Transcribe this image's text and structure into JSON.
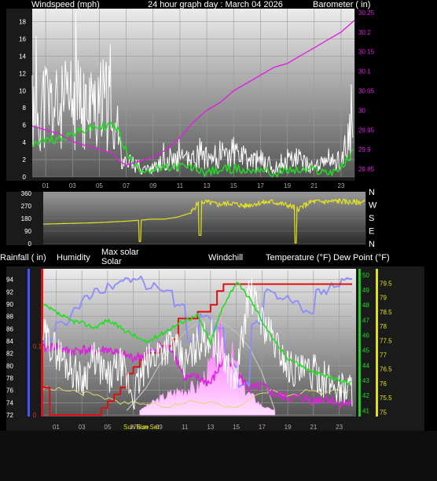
{
  "header": {
    "wind_title": "Windspeed (mph)",
    "graph_title": "24 hour graph day : March 04 2026",
    "baro_title": "Barometer ( in)"
  },
  "bottom_header": {
    "rain": "Rainfall ( in)",
    "humidity": "Humidity",
    "solar_line1": "Max solar",
    "solar_line2": "Solar",
    "windchill": "Windchill",
    "temperature": "Temperature (°F)",
    "dewpoint": "Dew Point (°F)",
    "sunrise": "Sun Rise",
    "sunset": "Sun Set"
  },
  "colors": {
    "wind": "#ffffff",
    "gust": "#22dd22",
    "baro": "#e020e0",
    "direction": "#e0e020",
    "rain": "#dd1111",
    "humidity": "#8c8cff",
    "solar": "#ffa0ff",
    "max_solar": "#c0c0c0",
    "temperature": "#22dd22",
    "dewpoint": "#e020e0",
    "windchill": "#ffffff",
    "et": "#d8d870",
    "bg": "#000000"
  },
  "chart_data": [
    {
      "type": "line",
      "name": "wind",
      "x_ticks": [
        "01",
        "03",
        "05",
        "07",
        "09",
        "11",
        "13",
        "15",
        "17",
        "19",
        "21",
        "23"
      ],
      "xlim": [
        0,
        24
      ],
      "y_left_ticks": [
        "0",
        "2",
        "4",
        "6",
        "8",
        "10",
        "12",
        "14",
        "16",
        "18"
      ],
      "ylim_left": [
        0,
        19.5
      ],
      "y_right_ticks": [
        "29.85",
        "29.9",
        "29.95",
        "30",
        "30.05",
        "30.1",
        "30.15",
        "30.2",
        "30.25"
      ],
      "ylim_right": [
        29.83,
        30.26
      ],
      "series": [
        {
          "name": "Windspeed",
          "x": [
            0,
            1,
            2,
            3,
            4,
            5,
            6,
            6.5,
            7,
            7.5,
            8,
            9,
            10,
            11,
            12,
            13,
            14,
            15,
            16,
            17,
            18,
            19,
            20,
            21,
            22,
            23,
            24
          ],
          "y": [
            8,
            9,
            8,
            9,
            8,
            9,
            8,
            4,
            1,
            2,
            1,
            1,
            2,
            2,
            2,
            3,
            2,
            3,
            2,
            2,
            1,
            2,
            2,
            1,
            2,
            2,
            6
          ]
        },
        {
          "name": "Gust",
          "x": [
            0,
            1,
            2,
            3,
            4,
            5,
            6,
            6.5,
            7,
            7.5,
            8,
            9,
            10,
            11,
            12,
            13,
            14,
            15,
            16,
            17,
            18,
            19,
            20,
            21,
            22,
            23,
            24
          ],
          "y": [
            4,
            4.2,
            4.5,
            5,
            5.5,
            5.8,
            6,
            5,
            3,
            1.5,
            1,
            0.8,
            1,
            1.2,
            1,
            0.5,
            0.8,
            1,
            0.6,
            1,
            0.2,
            0.8,
            0.7,
            0.8,
            0.5,
            1,
            3
          ]
        },
        {
          "name": "Barometer",
          "x": [
            0,
            1,
            2,
            3,
            4,
            5,
            6,
            6.5,
            7,
            8,
            9,
            10,
            11,
            12,
            13,
            14,
            15,
            16,
            17,
            18,
            19,
            20,
            21,
            22,
            23,
            24
          ],
          "y": [
            29.96,
            29.95,
            29.94,
            29.92,
            29.91,
            29.9,
            29.89,
            29.87,
            29.86,
            29.87,
            29.88,
            29.9,
            29.93,
            29.97,
            30.0,
            30.02,
            30.05,
            30.07,
            30.09,
            30.11,
            30.12,
            30.14,
            30.16,
            30.18,
            30.2,
            30.23
          ]
        }
      ]
    },
    {
      "type": "line",
      "name": "wind direction",
      "y_ticks": [
        "0",
        "90",
        "180",
        "270",
        "360"
      ],
      "ylim": [
        0,
        360
      ],
      "direction_labels": [
        "N",
        "W",
        "S",
        "E",
        "N"
      ],
      "series": [
        {
          "name": "Wind direction",
          "x": [
            0,
            2,
            4,
            6,
            7.5,
            8,
            9,
            10,
            11,
            11.5,
            12,
            13,
            14,
            15,
            16,
            17,
            18,
            19,
            20,
            21,
            22,
            23,
            24
          ],
          "y": [
            140,
            145,
            150,
            160,
            170,
            175,
            175,
            190,
            220,
            290,
            300,
            280,
            290,
            270,
            290,
            300,
            280,
            250,
            300,
            300,
            305,
            295,
            300
          ]
        }
      ]
    },
    {
      "type": "line",
      "name": "temperature humidity solar rain",
      "xlim": [
        0,
        24
      ],
      "x_ticks": [
        "01",
        "03",
        "05",
        "07",
        "09",
        "11",
        "13",
        "15",
        "17",
        "19",
        "21",
        "23"
      ],
      "humidity_ticks": [
        "72",
        "74",
        "76",
        "78",
        "80",
        "82",
        "84",
        "86",
        "88",
        "90",
        "92",
        "94"
      ],
      "humidity_lim": [
        72,
        95.5
      ],
      "rain_ticks": [
        "0",
        "0.1"
      ],
      "rain_lim": [
        0,
        0.21
      ],
      "temp_ticks": [
        "41",
        "42",
        "43",
        "44",
        "45",
        "46",
        "47",
        "48",
        "49",
        "50"
      ],
      "temp_lim": [
        40.7,
        50.3
      ],
      "dew_ticks": [
        "75",
        "75.5",
        "76",
        "76.5",
        "77",
        "77.5",
        "78",
        "78.5",
        "79",
        "79.5"
      ],
      "dew_lim": [
        74.9,
        79.95
      ],
      "series": [
        {
          "name": "Humidity",
          "x": [
            0,
            1,
            2,
            3,
            4,
            5,
            6,
            7,
            8,
            9,
            10,
            11,
            12,
            13,
            14,
            15,
            16,
            17,
            18,
            19,
            20,
            21,
            22,
            23,
            24
          ],
          "y": [
            84,
            87,
            89,
            91,
            92,
            93,
            94,
            94,
            93,
            92,
            90,
            84,
            88,
            86,
            80,
            77,
            87,
            92,
            91,
            90,
            89,
            92,
            93,
            94,
            94
          ]
        },
        {
          "name": "Temperature",
          "x": [
            0,
            1,
            2,
            3,
            4,
            5,
            6,
            7,
            8,
            9,
            10,
            11,
            12,
            13,
            14,
            15,
            16,
            17,
            18,
            19,
            20,
            21,
            22,
            23,
            24
          ],
          "y": [
            48,
            47.5,
            47,
            46.8,
            46.5,
            47,
            46.5,
            46,
            45.5,
            46,
            46.5,
            47,
            47.3,
            45.5,
            48,
            49.5,
            48.5,
            47,
            45.5,
            44.5,
            44,
            43.5,
            43.3,
            43,
            42.8
          ]
        },
        {
          "name": "Dew Point",
          "x": [
            0,
            1,
            2,
            3,
            4,
            5,
            6,
            7,
            8,
            9,
            10,
            11,
            12,
            13,
            14,
            15,
            16,
            17,
            18,
            19,
            20,
            21,
            22,
            23,
            24
          ],
          "y": [
            77.2,
            77.3,
            77.1,
            77.2,
            77.1,
            77.2,
            77.0,
            76.9,
            77.0,
            77.3,
            77.2,
            76.2,
            76.2,
            76.0,
            76.8,
            76.4,
            75.8,
            75.9,
            75.6,
            75.5,
            75.5,
            75.4,
            75.5,
            75.3,
            75.3
          ]
        },
        {
          "name": "Windchill",
          "x": [
            0,
            1,
            2,
            3,
            4,
            5,
            6,
            7,
            8,
            9,
            10,
            11,
            12,
            13,
            14,
            15,
            16,
            17,
            18,
            19,
            20,
            21,
            22,
            23,
            24
          ],
          "y": [
            46,
            45,
            44,
            43,
            44.5,
            43,
            44,
            42,
            44,
            45,
            45.5,
            44,
            45.5,
            46,
            44.5,
            43,
            49,
            47,
            45.5,
            44,
            43.5,
            43.5,
            43,
            42.5,
            42.5
          ]
        },
        {
          "name": "Rainfall",
          "x": [
            0,
            0.5,
            0.5,
            4,
            4.5,
            5,
            5.5,
            6,
            6.5,
            7,
            7.5,
            8,
            9,
            10,
            10.5,
            11,
            12,
            13,
            13.5,
            14,
            16,
            16.5,
            18,
            19,
            20,
            23.5,
            24
          ],
          "y": [
            0.04,
            0.04,
            0,
            0,
            0.01,
            0.02,
            0.03,
            0.04,
            0.06,
            0.07,
            0.08,
            0.09,
            0.1,
            0.11,
            0.14,
            0.14,
            0.15,
            0.16,
            0.18,
            0.19,
            0.19,
            0.19,
            0.19,
            0.19,
            0.19,
            0.19,
            0.19
          ]
        },
        {
          "name": "Solar",
          "x": [
            7.5,
            8,
            9,
            10,
            11,
            12,
            13,
            13.5,
            14,
            14.5,
            15,
            15.5,
            16,
            17,
            18
          ],
          "y": [
            0,
            0.3,
            0.8,
            1.2,
            1.5,
            1.6,
            3.0,
            4.0,
            5.5,
            4.0,
            3.0,
            1.6,
            1.2,
            0.3,
            0
          ]
        },
        {
          "name": "Max solar",
          "x": [
            6.5,
            8,
            9,
            10,
            11,
            12,
            13,
            14,
            15,
            16,
            17,
            18
          ],
          "y": [
            0,
            1.5,
            3,
            4.2,
            5.2,
            5.8,
            6,
            5.8,
            5.2,
            4.2,
            2.5,
            0
          ]
        }
      ]
    }
  ]
}
